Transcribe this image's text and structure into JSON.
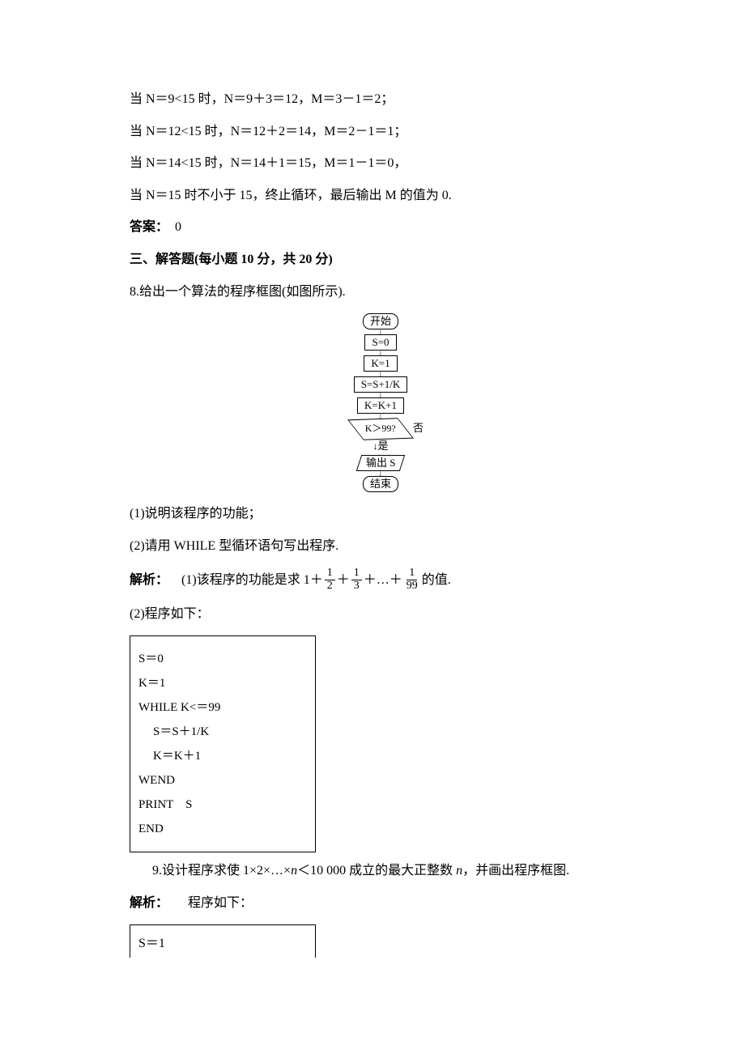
{
  "text": {
    "t1": "当 N＝9<15 时，N＝9＋3＝12，M＝3－1＝2；",
    "t2": "当 N＝12<15 时，N＝12＋2＝14，M＝2－1＝1；",
    "t3": "当 N＝14<15 时，N＝14＋1＝15，M＝1－1＝0，",
    "t4": "当 N＝15 时不小于 15，终止循环，最后输出 M 的值为 0.",
    "ans_label": "答案：",
    "ans_value": "　0",
    "sec3": "三、解答题(每小题 10 分，共 20 分)",
    "q8_stem": "8.给出一个算法的程序框图(如图所示).",
    "q8_p1": "(1)说明该程序的功能；",
    "q8_p2": "(2)请用 WHILE 型循环语句写出程序.",
    "solve_label": "解析：",
    "q8_sol1_pre": "(1)该程序的功能是求 1＋",
    "plus": "＋",
    "dots": "…",
    "q8_sol1_post": "的值.",
    "q8_sol2_head": "(2)程序如下：",
    "code": {
      "c1": "S＝0",
      "c2": "K＝1",
      "c3": "WHILE K<＝99",
      "c4": "S＝S＋1/K",
      "c5": "K＝K＋1",
      "c6": "WEND",
      "c7": "PRINT　S",
      "c8": "END"
    },
    "q9_stem_a": "9.设计程序求使 1×2×…×",
    "q9_stem_b": "n",
    "q9_stem_c": "＜10 000 成立的最大正整数 ",
    "q9_stem_d": "n",
    "q9_stem_e": "，并画出程序框图.",
    "q9_sol_head": "程序如下：",
    "code2": {
      "c1": "S＝1"
    }
  },
  "fractions": {
    "f2": {
      "num": "1",
      "den": "2"
    },
    "f3": {
      "num": "1",
      "den": "3"
    },
    "f99": {
      "num": "1",
      "den": "99"
    }
  },
  "flowchart": {
    "start": "开始",
    "s0": "S=0",
    "k1": "K=1",
    "update_s": "S=S+1/K",
    "update_k": "K=K+1",
    "cond": "K＞99?",
    "no": "否",
    "yes": "是",
    "output": "输出 S",
    "end": "结束"
  }
}
